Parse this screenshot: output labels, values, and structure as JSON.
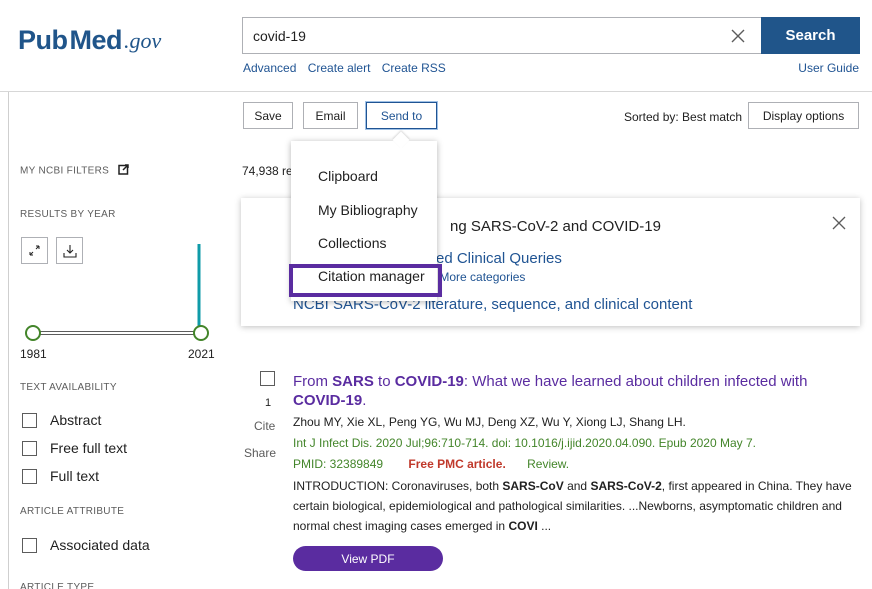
{
  "header": {
    "logo": {
      "pub": "Pub",
      "med": "Med",
      "gov": ".gov"
    },
    "search": {
      "value": "covid-19",
      "button": "Search"
    },
    "links": [
      "Advanced",
      "Create alert",
      "Create RSS"
    ],
    "user_guide": "User Guide"
  },
  "toolbar": {
    "save": "Save",
    "email": "Email",
    "send_to": "Send to",
    "sorted_by": "Sorted by: Best match",
    "display_options": "Display options"
  },
  "dropdown": {
    "items": [
      "Clipboard",
      "My Bibliography",
      "Collections",
      "Citation manager"
    ],
    "highlighted": "Citation manager"
  },
  "sidebar": {
    "my_ncbi_filters": "MY NCBI FILTERS",
    "results_by_year": "RESULTS BY YEAR",
    "year_start": "1981",
    "year_end": "2021",
    "text_availability": "TEXT AVAILABILITY",
    "text_filters": [
      "Abstract",
      "Free full text",
      "Full text"
    ],
    "article_attribute": "ARTICLE ATTRIBUTE",
    "attribute_filters": [
      "Associated data"
    ],
    "article_type": "ARTICLE TYPE"
  },
  "main": {
    "result_count": "74,938 re",
    "covid_box": {
      "title": "ng SARS-CoV-2 and COVID-19",
      "link1": "ed Clinical Queries",
      "sub_links": [
        "ransmission",
        "More categories"
      ],
      "link2": "NCBI SARS-CoV-2 literature, sequence, and clinical content"
    },
    "result": {
      "number": "1",
      "actions": [
        "Cite",
        "Share"
      ],
      "title_parts": [
        {
          "text": "From ",
          "bold": false
        },
        {
          "text": "SARS",
          "bold": true
        },
        {
          "text": " to ",
          "bold": false
        },
        {
          "text": "COVID-19",
          "bold": true
        },
        {
          "text": ": What we have learned about children infected with ",
          "bold": false
        },
        {
          "text": "COVID-19",
          "bold": true
        },
        {
          "text": ".",
          "bold": false
        }
      ],
      "authors": "Zhou MY, Xie XL, Peng YG, Wu MJ, Deng XZ, Wu Y, Xiong LJ, Shang LH.",
      "journal": "Int J Infect Dis. 2020 Jul;96:710-714. doi: 10.1016/j.ijid.2020.04.090. Epub 2020 May 7.",
      "pmid": "PMID: 32389849",
      "free_pmc": "Free PMC article.",
      "review": "Review.",
      "snippet_parts": [
        {
          "text": "INTRODUCTION: Coronaviruses, both ",
          "bold": false
        },
        {
          "text": "SARS-CoV",
          "bold": true
        },
        {
          "text": " and ",
          "bold": false
        },
        {
          "text": "SARS-CoV-2",
          "bold": true
        },
        {
          "text": ", first appeared in China. They have certain biological, epidemiological and pathological similarities. ...Newborns, asymptomatic children and normal chest imaging cases emerged in ",
          "bold": false
        },
        {
          "text": "COVI",
          "bold": true
        },
        {
          "text": " ...",
          "bold": false
        }
      ],
      "view_pdf": "View PDF"
    }
  },
  "colors": {
    "brand_blue": "#20558a",
    "link_blue": "#205493",
    "purple": "#5a2ca0",
    "teal": "#0f9ba8",
    "green": "#43852a",
    "pmc_red": "#c0392b"
  }
}
